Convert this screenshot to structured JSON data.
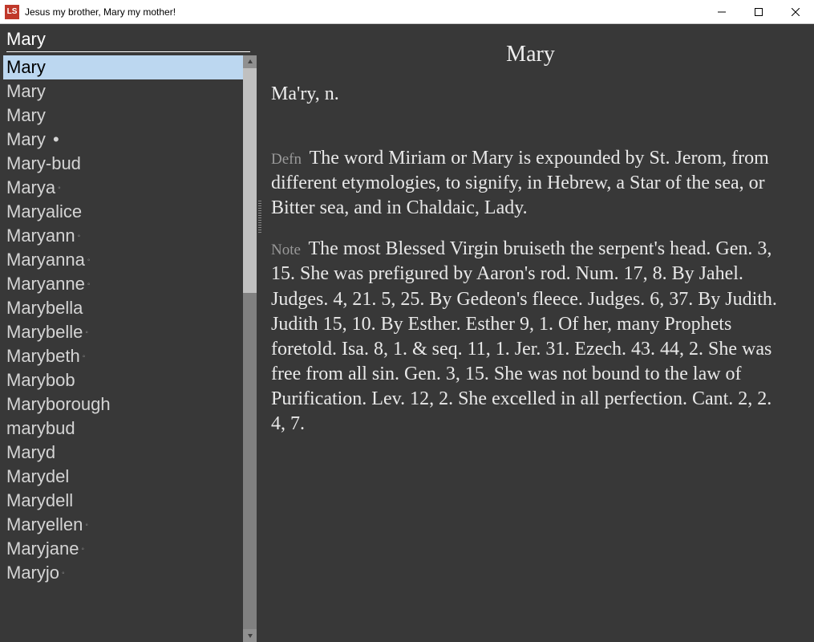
{
  "window": {
    "title": "Jesus my brother, Mary my mother!",
    "icon_text": "LS"
  },
  "search": {
    "value": "Mary"
  },
  "wordlist": [
    {
      "text": "Mary",
      "selected": true,
      "marker": ""
    },
    {
      "text": "Mary",
      "selected": false,
      "marker": ""
    },
    {
      "text": "Mary",
      "selected": false,
      "marker": ""
    },
    {
      "text": "Mary",
      "selected": false,
      "marker": "bullet"
    },
    {
      "text": "Mary-bud",
      "selected": false,
      "marker": ""
    },
    {
      "text": "Marya",
      "selected": false,
      "marker": "dot"
    },
    {
      "text": "Maryalice",
      "selected": false,
      "marker": ""
    },
    {
      "text": "Maryann",
      "selected": false,
      "marker": "dot"
    },
    {
      "text": "Maryanna",
      "selected": false,
      "marker": "dot"
    },
    {
      "text": "Maryanne",
      "selected": false,
      "marker": "dot"
    },
    {
      "text": "Marybella",
      "selected": false,
      "marker": ""
    },
    {
      "text": "Marybelle",
      "selected": false,
      "marker": "dot"
    },
    {
      "text": "Marybeth",
      "selected": false,
      "marker": "dot"
    },
    {
      "text": "Marybob",
      "selected": false,
      "marker": ""
    },
    {
      "text": "Maryborough",
      "selected": false,
      "marker": ""
    },
    {
      "text": "marybud",
      "selected": false,
      "marker": ""
    },
    {
      "text": "Maryd",
      "selected": false,
      "marker": ""
    },
    {
      "text": "Marydel",
      "selected": false,
      "marker": ""
    },
    {
      "text": "Marydell",
      "selected": false,
      "marker": ""
    },
    {
      "text": "Maryellen",
      "selected": false,
      "marker": "dot"
    },
    {
      "text": "Maryjane",
      "selected": false,
      "marker": "dot"
    },
    {
      "text": "Maryjo",
      "selected": false,
      "marker": "dot"
    }
  ],
  "article": {
    "title": "Mary",
    "pronunciation": "Ma'ry, n.",
    "defn_label": "Defn",
    "defn_text": "The word Miriam or Mary is expounded by St. Jerom, from different etymologies, to signify, in Hebrew, a Star of the sea, or Bitter sea, and in Chaldaic, Lady.",
    "note_label": "Note",
    "note_text": "The most Blessed Virgin bruiseth the serpent's head. Gen. 3, 15. She was prefigured by Aaron's rod. Num. 17, 8. By Jahel. Judges. 4, 21. 5, 25. By Gedeon's fleece. Judges. 6, 37. By Judith. Judith 15, 10. By Esther. Esther 9, 1. Of her, many Prophets foretold. Isa. 8, 1. & seq. 11, 1. Jer. 31. Ezech. 43. 44, 2. She was free from all sin. Gen. 3, 15. She was not bound to the law of Purification. Lev. 12, 2. She excelled in all perfection. Cant. 2, 2. 4, 7."
  }
}
